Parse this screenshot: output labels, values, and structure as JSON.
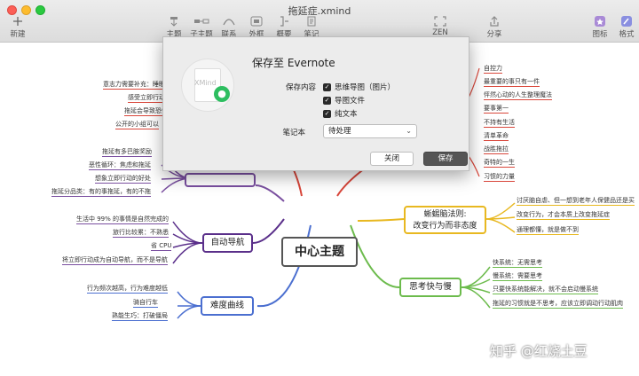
{
  "window": {
    "title": "拖延症.xmind"
  },
  "toolbar": {
    "new": "新建",
    "topic": "主题",
    "subtopic": "子主题",
    "link": "联系",
    "boundary": "外框",
    "summary": "概要",
    "note": "笔记",
    "zen": "ZEN",
    "share": "分享",
    "icons": "图标",
    "format": "格式"
  },
  "mindmap": {
    "central": "中心主题",
    "red_left": [
      "意志力需要补充：睡眠",
      "感受立即行动",
      "拖延会导致恐惧",
      "公开的小组可以"
    ],
    "purple_left": [
      "拖延有多巴胺奖励",
      "恶性循环：焦虑和拖延",
      "想象立即行动的好处",
      "拖延分品类：有的事拖延，有的不拖"
    ],
    "auto_nav": {
      "label": "自动导航",
      "items": [
        "生活中 99% 的事情是自然完成的",
        "旅行比较累：不熟悉",
        "省 CPU",
        "将立即行动成为自动导航，而不是导航"
      ]
    },
    "difficulty": {
      "label": "难度曲线",
      "items": [
        "行为频次越高，行为难度越低",
        "骑自行车",
        "熟能生巧：打破僵局"
      ]
    },
    "red_right": [
      "自控力",
      "最重要的事只有一件",
      "怦然心动的人生整理魔法",
      "要事第一",
      "不持有生活",
      "清单革命",
      "战胜拖拉",
      "奇特的一生",
      "习惯的力量"
    ],
    "lizard": {
      "label_line1": "蜥蜴脑法则:",
      "label_line2": "改变行为而非态度",
      "items": [
        "讨厌脑自虐、但一想到老年人保健品还是买",
        "改变行为，才会本质上改变拖延症",
        "通理都懂，就是做不到"
      ]
    },
    "think": {
      "label": "思考快与慢",
      "items": [
        "快系统：无需思考",
        "慢系统：需要思考",
        "只要快系统能解决，就不会启动慢系统",
        "拖延的习惯就是不思考，应该立即调动行动肌肉"
      ]
    }
  },
  "dialog": {
    "title": "保存至 Evernote",
    "content_label": "保存内容",
    "options": [
      "思维导图（图片）",
      "导图文件",
      "纯文本"
    ],
    "notebook_label": "笔记本",
    "notebook_value": "待处理",
    "close_button": "关闭",
    "save_button": "保存",
    "icon_text": "XMind"
  },
  "watermark": "知乎 @红烧土豆"
}
